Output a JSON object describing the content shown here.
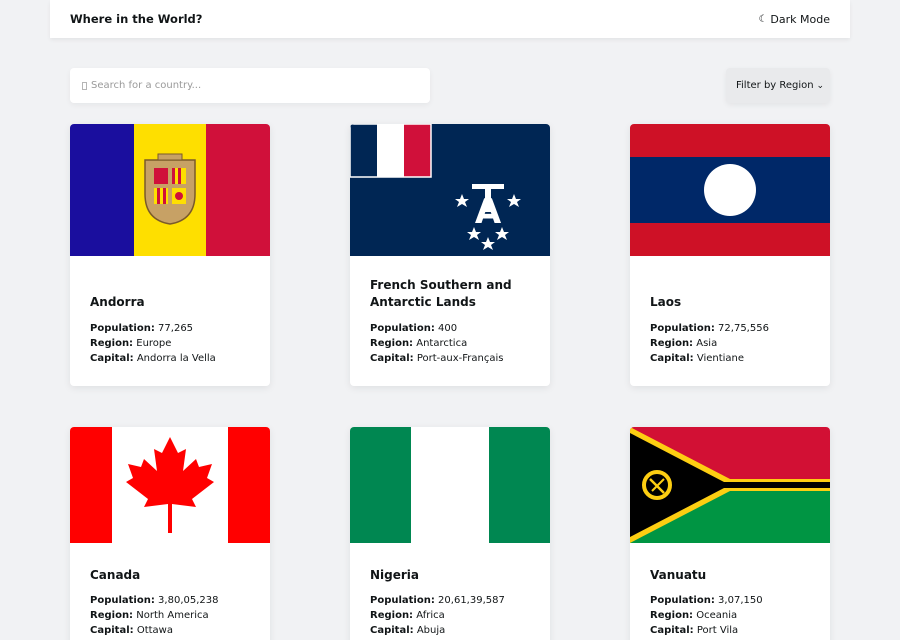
{
  "header": {
    "title": "Where in the World?",
    "dark_mode_label": "Dark Mode",
    "moon_glyph": "☾"
  },
  "search": {
    "placeholder": "Search for a country...",
    "value": ""
  },
  "filter": {
    "label": "Filter by Region"
  },
  "labels": {
    "population": "Population:",
    "region": "Region:",
    "capital": "Capital:"
  },
  "countries": [
    {
      "name": "Andorra",
      "population": "77,265",
      "region": "Europe",
      "capital": "Andorra la Vella",
      "flag_icon": "andorra-flag"
    },
    {
      "name": "French Southern and Antarctic Lands",
      "population": "400",
      "region": "Antarctica",
      "capital": "Port-aux-Français",
      "flag_icon": "french-southern-flag"
    },
    {
      "name": "Laos",
      "population": "72,75,556",
      "region": "Asia",
      "capital": "Vientiane",
      "flag_icon": "laos-flag"
    },
    {
      "name": "Canada",
      "population": "3,80,05,238",
      "region": "North America",
      "capital": "Ottawa",
      "flag_icon": "canada-flag"
    },
    {
      "name": "Nigeria",
      "population": "20,61,39,587",
      "region": "Africa",
      "capital": "Abuja",
      "flag_icon": "nigeria-flag"
    },
    {
      "name": "Vanuatu",
      "population": "3,07,150",
      "region": "Oceania",
      "capital": "Port Vila",
      "flag_icon": "vanuatu-flag"
    }
  ],
  "colors": {
    "background": "#f1f2f4",
    "card": "#ffffff",
    "text": "#111517"
  }
}
